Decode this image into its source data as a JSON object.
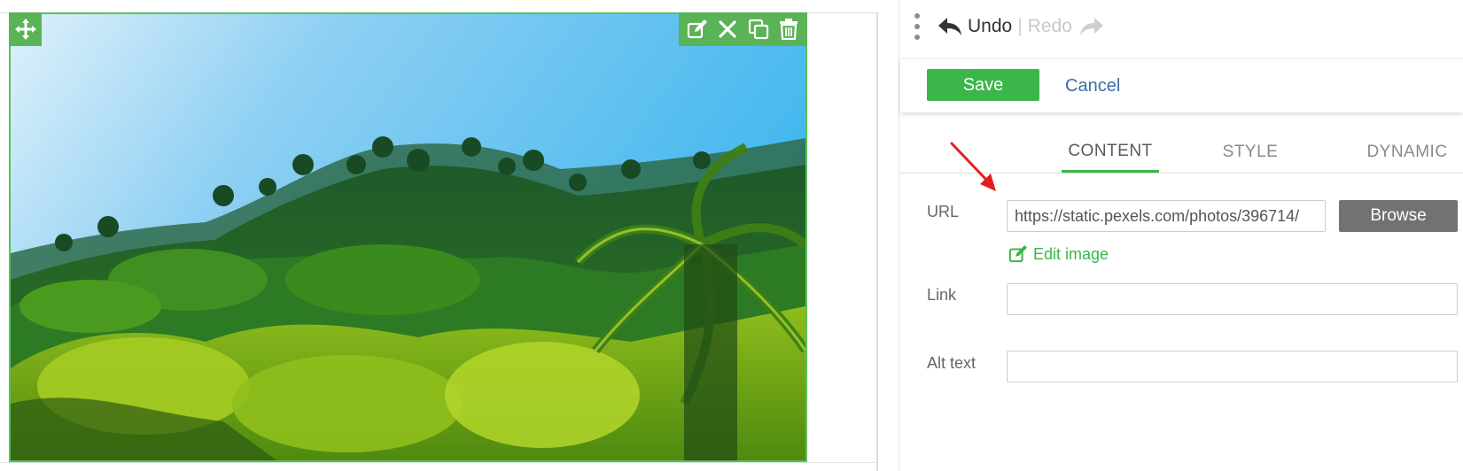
{
  "history": {
    "undo_label": "Undo",
    "separator": "|",
    "redo_label": "Redo"
  },
  "actions": {
    "save_label": "Save",
    "cancel_label": "Cancel"
  },
  "tabs": [
    {
      "label": "CONTENT",
      "active": true
    },
    {
      "label": "STYLE",
      "active": false
    },
    {
      "label": "DYNAMIC",
      "active": false
    }
  ],
  "content": {
    "url_label": "URL",
    "url_value": "https://static.pexels.com/photos/396714/",
    "browse_label": "Browse",
    "edit_image_label": "Edit image",
    "link_label": "Link",
    "link_value": "",
    "alt_label": "Alt text",
    "alt_value": ""
  },
  "icons": {
    "move": "move-arrows-icon",
    "edit": "edit-icon",
    "close": "close-icon",
    "duplicate": "duplicate-icon",
    "delete": "trash-icon",
    "undo": "undo-arrow-icon",
    "redo": "redo-arrow-icon",
    "drag": "drag-handle-icon",
    "annotation": "red-arrow-icon"
  },
  "colors": {
    "accent_green": "#3cb54a",
    "toolbar_green": "#5ab356",
    "link_blue": "#3a6ea5",
    "browse_gray": "#727272",
    "annotation_red": "#e41e1e"
  }
}
